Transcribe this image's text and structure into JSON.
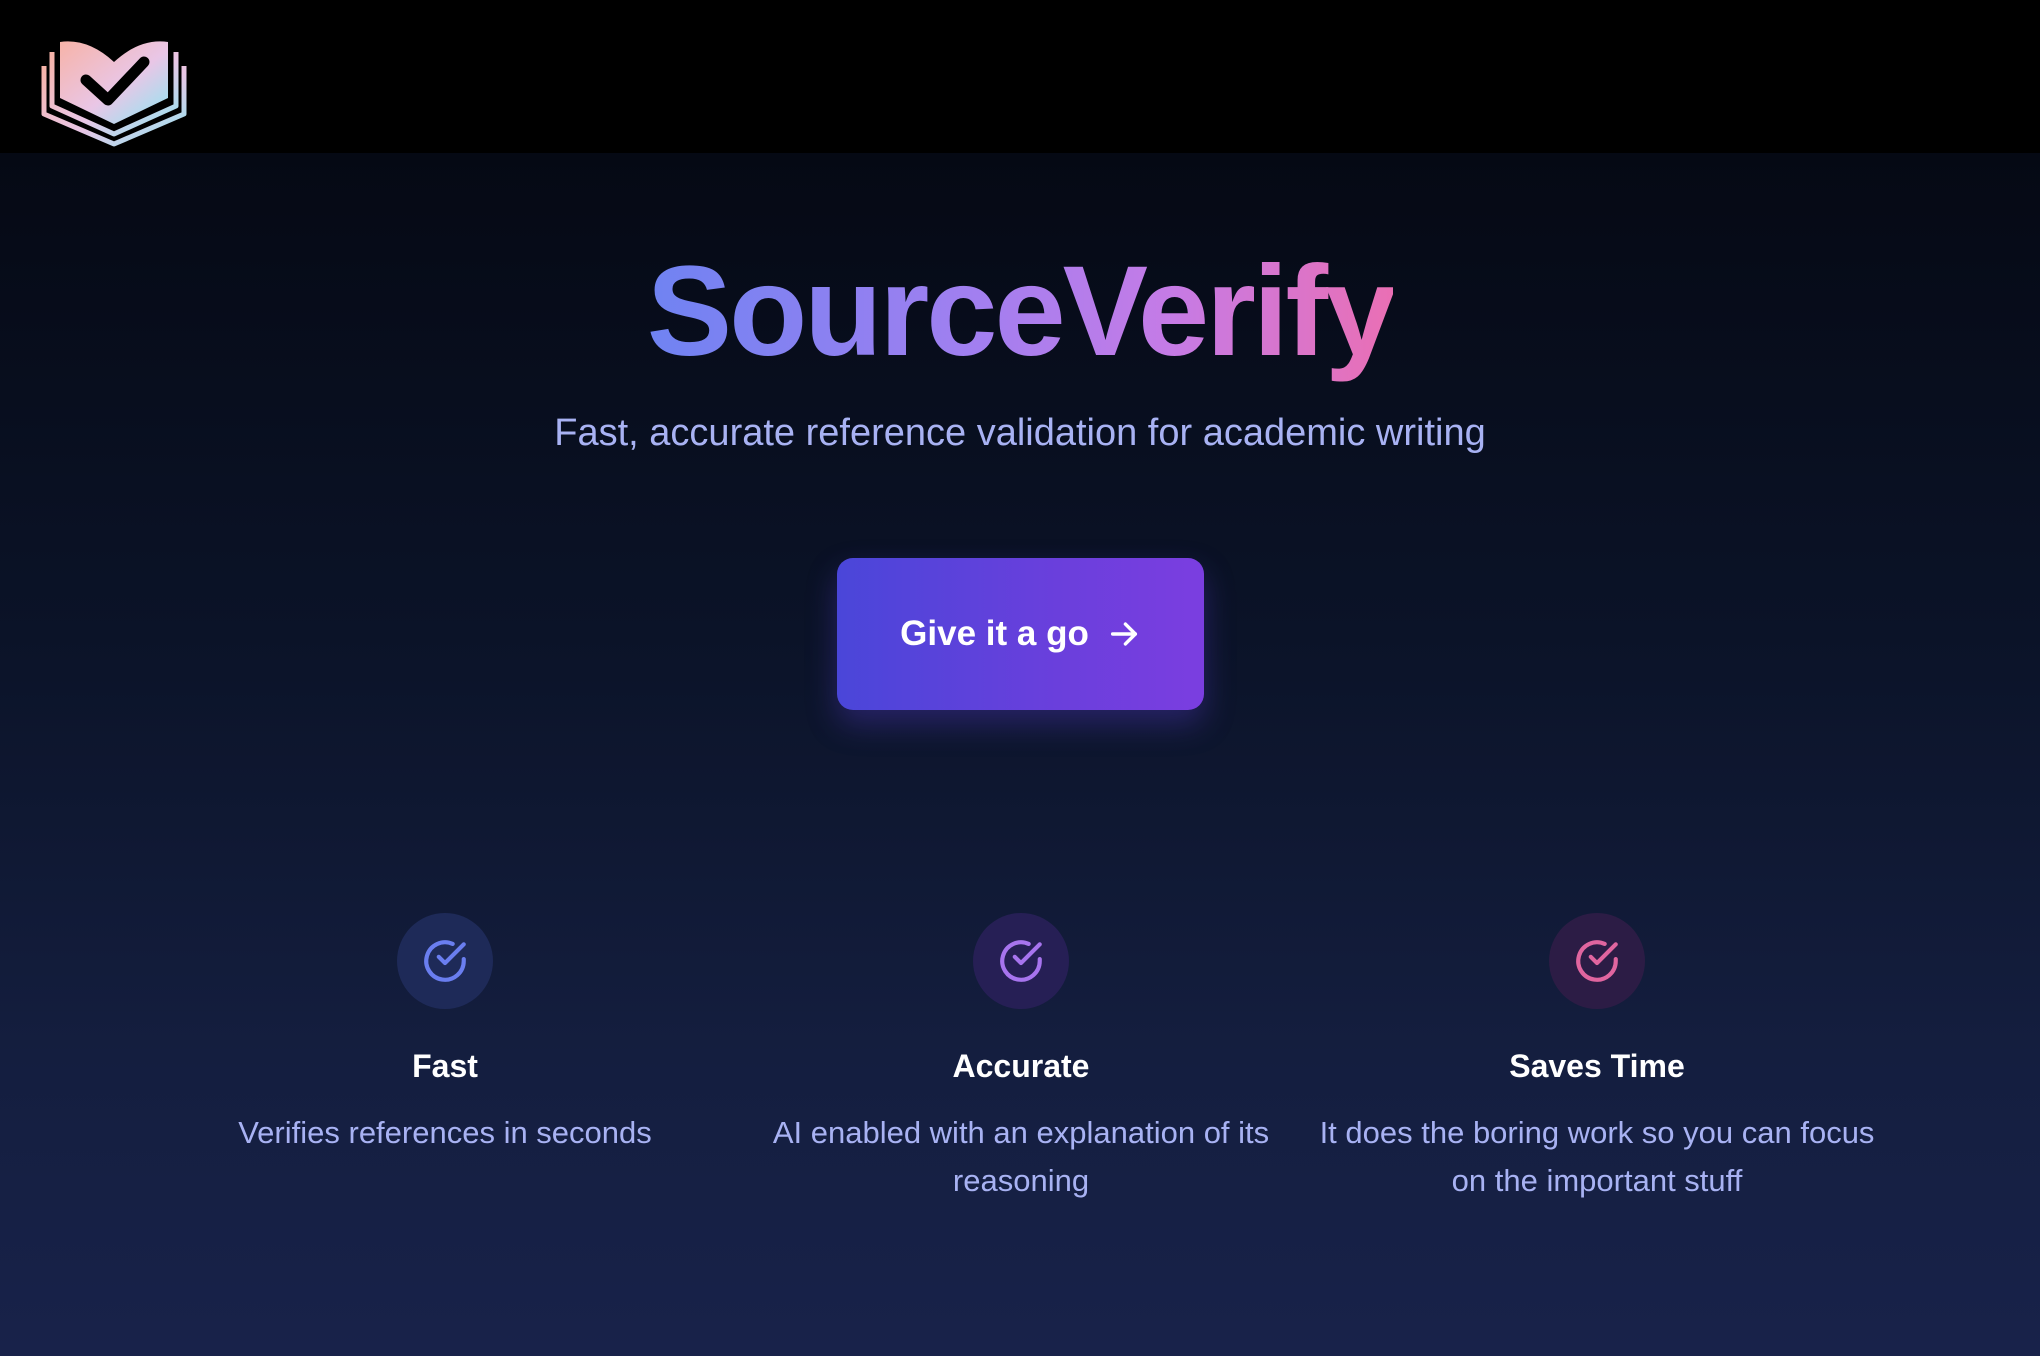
{
  "brand": {
    "logo_icon": "book-check-logo-icon",
    "title": "SourceVerify",
    "subtitle": "Fast, accurate reference validation for academic writing"
  },
  "cta": {
    "label": "Give it a go",
    "icon": "arrow-right-icon"
  },
  "features": [
    {
      "icon": "check-circle-icon",
      "color": "#6a7ef0",
      "title": "Fast",
      "description": "Verifies references in seconds"
    },
    {
      "icon": "check-circle-icon",
      "color": "#a774ee",
      "title": "Accurate",
      "description": "AI enabled with an explanation of its reasoning"
    },
    {
      "icon": "check-circle-icon",
      "color": "#e0659f",
      "title": "Saves Time",
      "description": "It does the boring work so you can focus on the important stuff"
    }
  ],
  "colors": {
    "title_gradient_start": "#6f83f2",
    "title_gradient_end": "#ea6fb4",
    "button_start": "#4a46d9",
    "button_end": "#7b3ee0",
    "subtitle": "#a8b2f3"
  }
}
